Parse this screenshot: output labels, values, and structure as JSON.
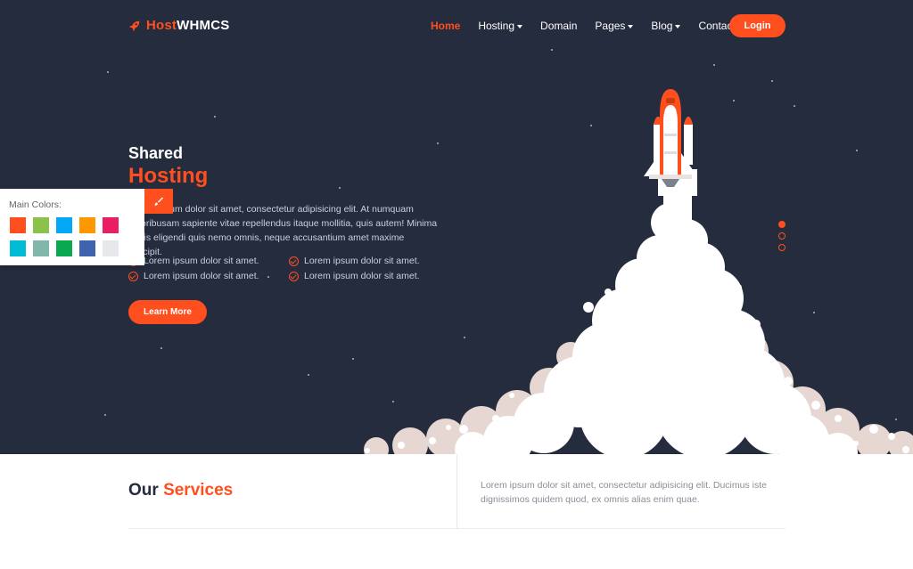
{
  "header": {
    "logo": {
      "prefix": "Host",
      "suffix": "WHMCS",
      "icon": "rocket-icon"
    },
    "nav": [
      {
        "label": "Home",
        "active": true,
        "dropdown": false
      },
      {
        "label": "Hosting",
        "active": false,
        "dropdown": true
      },
      {
        "label": "Domain",
        "active": false,
        "dropdown": false
      },
      {
        "label": "Pages",
        "active": false,
        "dropdown": true
      },
      {
        "label": "Blog",
        "active": false,
        "dropdown": true
      },
      {
        "label": "Contact",
        "active": false,
        "dropdown": false
      }
    ],
    "login_label": "Login"
  },
  "hero": {
    "title_line1": "Shared",
    "title_line2": "Hosting",
    "description": "Lorem ipsum dolor sit amet, consectetur adipisicing elit. At numquam doloribusam sapiente vitae repellendus itaque mollitia, quis autem! Minima nobis eligendi quis nemo omnis, neque accusantium amet maxime suscipit.",
    "features": [
      "Lorem ipsum dolor sit amet.",
      "Lorem ipsum dolor sit amet.",
      "Lorem ipsum dolor sit amet.",
      "Lorem ipsum dolor sit amet."
    ],
    "cta_label": "Learn More",
    "slides": 3,
    "active_slide": 1
  },
  "color_panel": {
    "title": "Main Colors:",
    "toggle_icon": "brush-icon",
    "swatches": [
      "#ff4f1f",
      "#8bc34a",
      "#03a9f4",
      "#ff9800",
      "#e91e63",
      "#00bcd4",
      "#80b7aa",
      "#0aa84f",
      "#3f63ad",
      "#e5e7ea"
    ]
  },
  "services": {
    "title_prefix": "Our",
    "title_accent": "Services",
    "description": "Lorem ipsum dolor sit amet, consectetur adipisicing elit. Ducimus iste dignissimos quidem quod, ex omnis alias enim quae."
  },
  "colors": {
    "accent": "#ff4f1f",
    "hero_bg": "#252c3e",
    "smoke": "#ffffff",
    "smoke_shadow": "#e6d7d2"
  }
}
